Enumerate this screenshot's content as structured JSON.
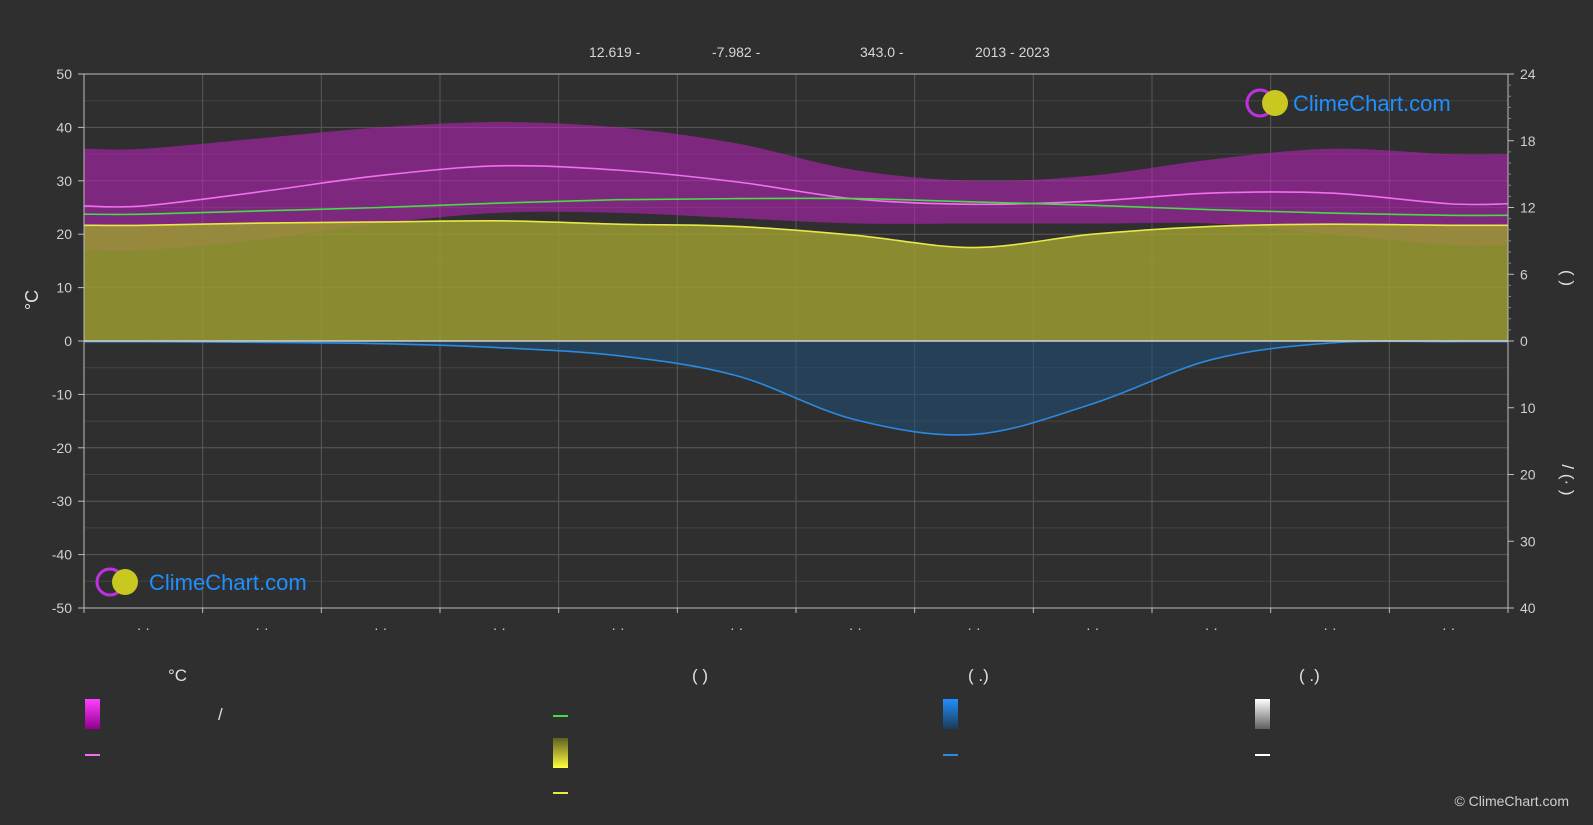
{
  "header": {
    "lat": "12.619 -",
    "lon": "-7.982 -",
    "elev": "343.0 -",
    "years": "2013 - 2023"
  },
  "chart_data": {
    "type": "area",
    "left_axis": {
      "label": "°C",
      "range": [
        -50,
        50
      ],
      "ticks": [
        50,
        40,
        30,
        20,
        10,
        0,
        -10,
        -20,
        -30,
        -40,
        -50
      ]
    },
    "right_axis_top": {
      "range": [
        0,
        24
      ],
      "ticks": [
        24,
        18,
        12,
        6,
        0
      ],
      "label": "(   )"
    },
    "right_axis_bottom": {
      "range": [
        0,
        40
      ],
      "ticks": [
        0,
        10,
        20,
        30,
        40
      ],
      "label": "/   (·   )"
    },
    "x_tick_labels": [
      "· ·",
      "· ·",
      "· ·",
      "· ·",
      "· ·",
      "· ·",
      "· ·",
      "· ·",
      "· ·",
      "· ·",
      "· ·",
      "· ·"
    ],
    "months": [
      1,
      2,
      3,
      4,
      5,
      6,
      7,
      8,
      9,
      10,
      11,
      12
    ],
    "series": [
      {
        "key": "temp_max_mean",
        "color": "#f070f0",
        "values": [
          25.3,
          28.0,
          31.0,
          32.8,
          32.0,
          29.8,
          26.6,
          25.6,
          26.2,
          27.7,
          27.7,
          25.7
        ]
      },
      {
        "key": "daylight_hours",
        "color": "#44dd44",
        "unit": "h",
        "values": [
          11.4,
          11.7,
          12.0,
          12.4,
          12.7,
          12.8,
          12.8,
          12.5,
          12.2,
          11.8,
          11.5,
          11.3
        ]
      },
      {
        "key": "sunshine_hours",
        "color": "#e8e84a",
        "unit": "h",
        "values": [
          10.4,
          10.6,
          10.7,
          10.8,
          10.5,
          10.3,
          9.5,
          8.4,
          9.6,
          10.3,
          10.5,
          10.4
        ]
      },
      {
        "key": "precip_mm",
        "color": "#2a8ae0",
        "unit": "mm",
        "values": [
          0.1,
          0.2,
          0.4,
          1.0,
          2.2,
          5.2,
          11.8,
          14.0,
          9.4,
          2.8,
          0.3,
          0.1
        ]
      }
    ],
    "temp_band": {
      "color": "#c020c0",
      "max": [
        36,
        38,
        40,
        41,
        40,
        37,
        32,
        30,
        31,
        34,
        36,
        35
      ],
      "min": [
        17,
        19,
        22,
        24,
        24,
        23,
        22,
        22,
        22,
        22,
        20,
        18
      ]
    }
  },
  "legend": {
    "col1": {
      "title": "°C",
      "label1": "/",
      "label2": ""
    },
    "col2": {
      "title": "(          )",
      "label1": "",
      "label2": "",
      "label3": ""
    },
    "col3": {
      "title": "(   .)",
      "label1": "",
      "label2": ""
    },
    "col4": {
      "title": "(   .)",
      "label1": "",
      "label2": ""
    }
  },
  "brand": {
    "name": "ClimeChart.com",
    "copyright": "© ClimeChart.com",
    "color": "#1e90ff"
  }
}
